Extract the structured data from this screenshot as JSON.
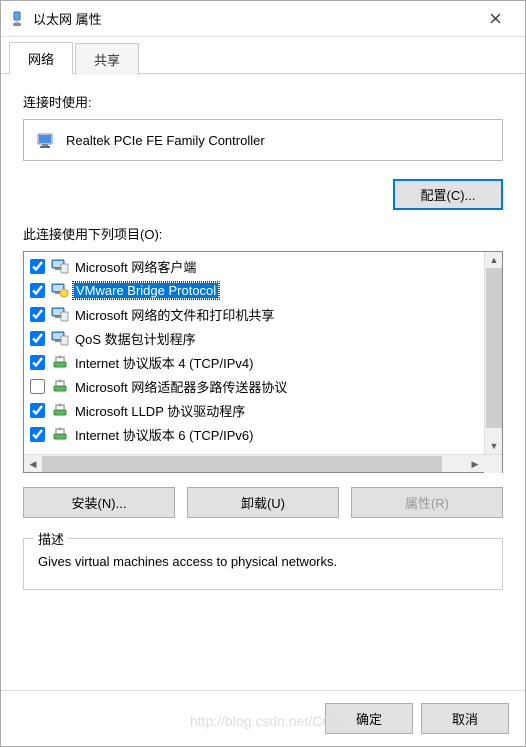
{
  "window": {
    "title": "以太网 属性",
    "tabs": [
      {
        "label": "网络",
        "active": true
      },
      {
        "label": "共享",
        "active": false
      }
    ]
  },
  "connect_using": {
    "label": "连接时使用:",
    "adapter": "Realtek PCIe FE Family Controller"
  },
  "configure_button": "配置(C)...",
  "items_label": "此连接使用下列项目(O):",
  "items": [
    {
      "checked": true,
      "icon": "client",
      "label": "Microsoft 网络客户端",
      "selected": false
    },
    {
      "checked": true,
      "icon": "bridge",
      "label": "VMware Bridge Protocol",
      "selected": true
    },
    {
      "checked": true,
      "icon": "client",
      "label": "Microsoft 网络的文件和打印机共享",
      "selected": false
    },
    {
      "checked": true,
      "icon": "client",
      "label": "QoS 数据包计划程序",
      "selected": false
    },
    {
      "checked": true,
      "icon": "proto",
      "label": "Internet 协议版本 4 (TCP/IPv4)",
      "selected": false
    },
    {
      "checked": false,
      "icon": "proto",
      "label": "Microsoft 网络适配器多路传送器协议",
      "selected": false
    },
    {
      "checked": true,
      "icon": "proto",
      "label": "Microsoft LLDP 协议驱动程序",
      "selected": false
    },
    {
      "checked": true,
      "icon": "proto",
      "label": "Internet 协议版本 6 (TCP/IPv6)",
      "selected": false
    }
  ],
  "buttons": {
    "install": "安装(N)...",
    "uninstall": "卸载(U)",
    "properties": "属性(R)",
    "properties_enabled": false
  },
  "description": {
    "legend": "描述",
    "text": "Gives virtual machines access to physical networks."
  },
  "dialog_buttons": {
    "ok": "确定",
    "cancel": "取消"
  },
  "watermark": "http://blog.csdn.net/CGS"
}
